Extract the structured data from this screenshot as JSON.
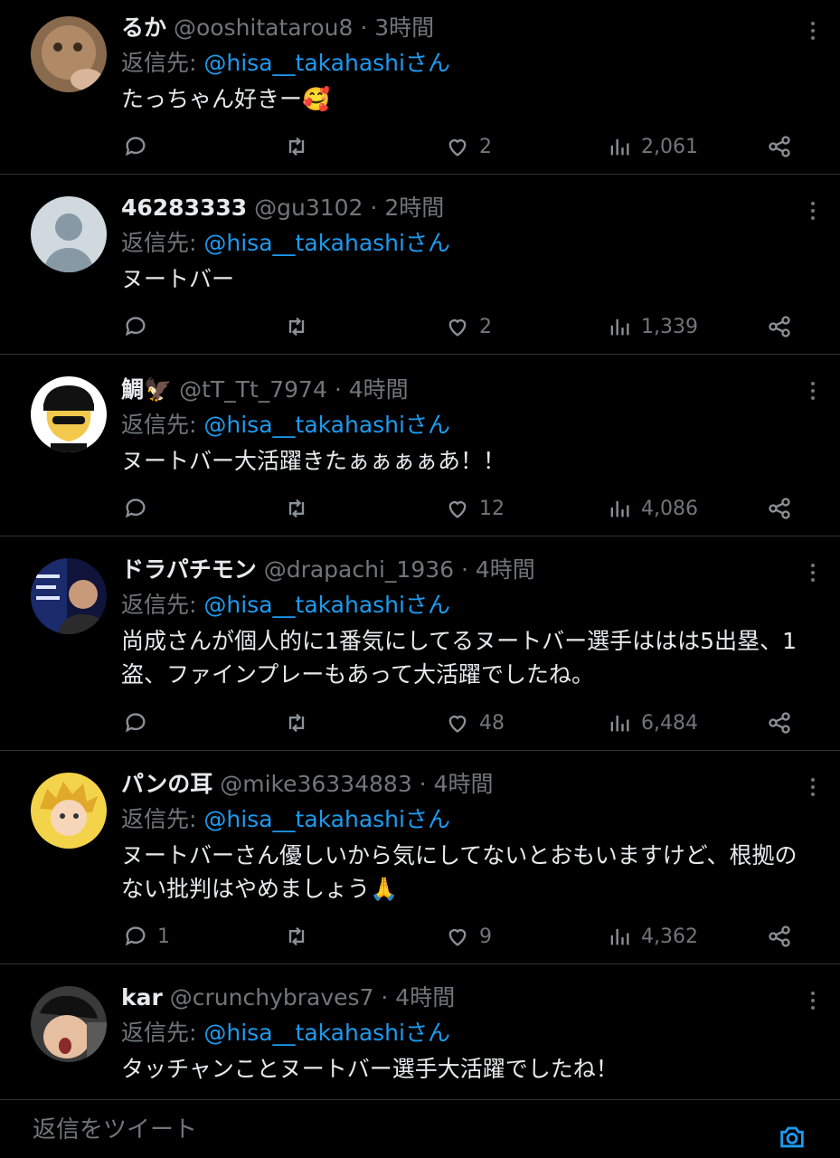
{
  "colors": {
    "background": "#000000",
    "accent": "#1d9bf0",
    "muted": "#71767b",
    "text": "#e7e9ea",
    "divider": "#2f3336"
  },
  "tweets": [
    {
      "name": "るか",
      "handle": "@ooshitatarou8",
      "time": "3時間",
      "reply_prefix": "返信先: ",
      "reply_mention": "@hisa__takahashiさん",
      "text": "たっちゃん好きー🥰",
      "replies": "",
      "likes": "2",
      "views": "2,061"
    },
    {
      "name": "46283333",
      "handle": "@gu3102",
      "time": "2時間",
      "reply_prefix": "返信先: ",
      "reply_mention": "@hisa__takahashiさん",
      "text": "ヌートバー",
      "replies": "",
      "likes": "2",
      "views": "1,339"
    },
    {
      "name": "鯛🦅",
      "handle": "@tT_Tt_7974",
      "time": "4時間",
      "reply_prefix": "返信先: ",
      "reply_mention": "@hisa__takahashiさん",
      "text": "ヌートバー大活躍きたぁぁぁぁあ！！",
      "replies": "",
      "likes": "12",
      "views": "4,086"
    },
    {
      "name": "ドラパチモン",
      "handle": "@drapachi_1936",
      "time": "4時間",
      "reply_prefix": "返信先: ",
      "reply_mention": "@hisa__takahashiさん",
      "text": "尚成さんが個人的に1番気にしてるヌートバー選手ははは5出塁、1盗、ファインプレーもあって大活躍でしたね。",
      "replies": "",
      "likes": "48",
      "views": "6,484"
    },
    {
      "name": "パンの耳",
      "handle": "@mike36334883",
      "time": "4時間",
      "reply_prefix": "返信先: ",
      "reply_mention": "@hisa__takahashiさん",
      "text": "ヌートバーさん優しいから気にしてないとおもいますけど、根拠のない批判はやめましょう🙏",
      "replies": "1",
      "likes": "9",
      "views": "4,362"
    },
    {
      "name": "kar",
      "handle": "@crunchybraves7",
      "time": "4時間",
      "reply_prefix": "返信先: ",
      "reply_mention": "@hisa__takahashiさん",
      "text": "タッチャンことヌートバー選手大活躍でしたね！"
    }
  ],
  "composer": {
    "placeholder": "返信をツイート"
  },
  "icons": [
    "more-icon",
    "reply-icon",
    "retweet-icon",
    "like-icon",
    "views-icon",
    "share-icon",
    "camera-icon"
  ]
}
